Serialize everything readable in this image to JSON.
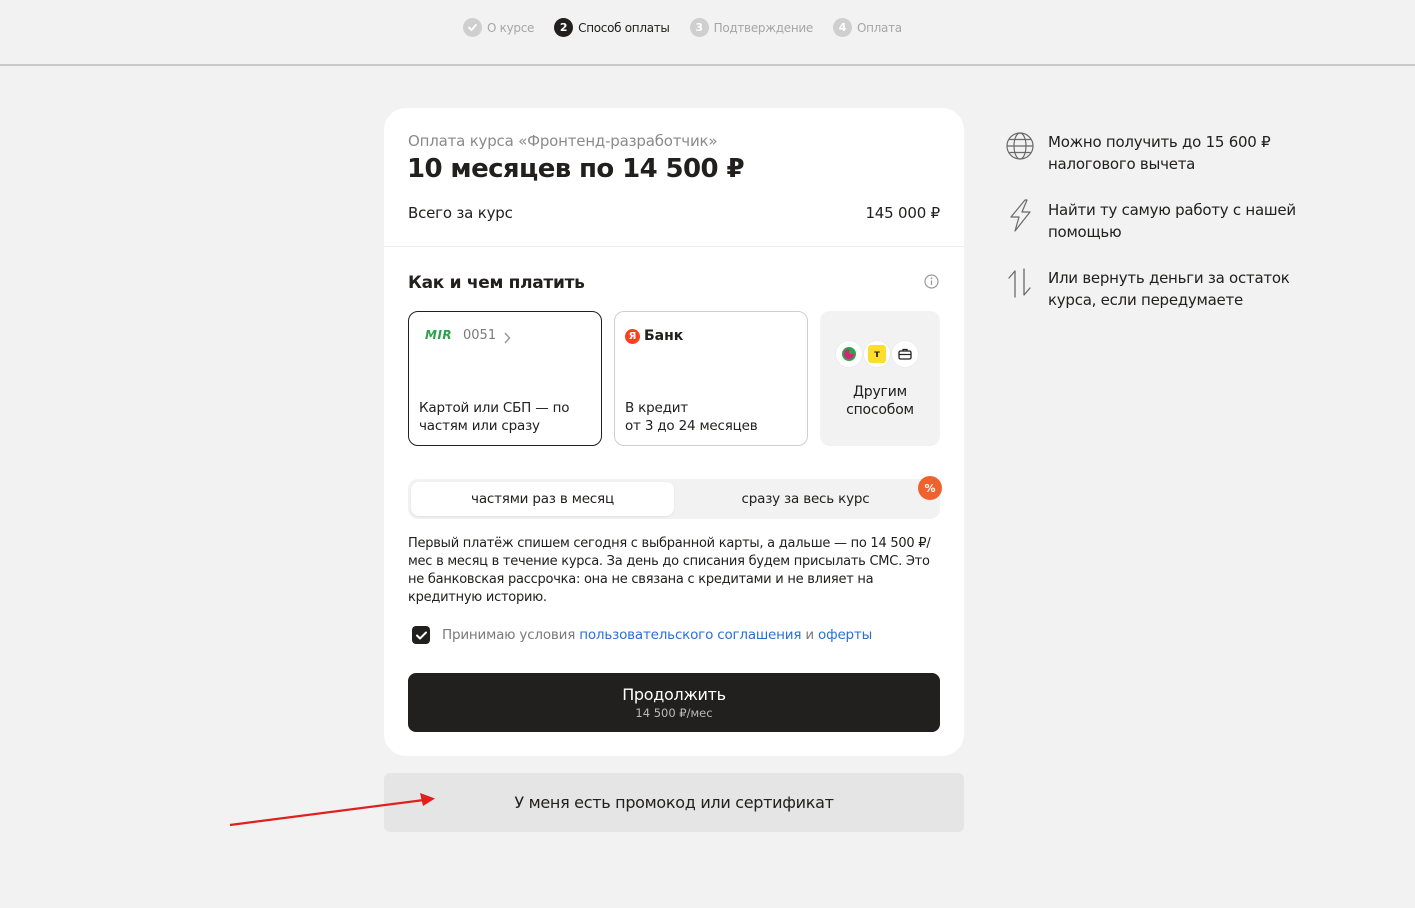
{
  "stepper": [
    {
      "label": "О курсе",
      "num": "",
      "state": "done"
    },
    {
      "label": "Способ оплаты",
      "num": "2",
      "state": "active"
    },
    {
      "label": "Подтверждение",
      "num": "3",
      "state": "todo"
    },
    {
      "label": "Оплата",
      "num": "4",
      "state": "todo"
    }
  ],
  "summary": {
    "course_title": "Оплата курса «Фронтенд-разработчик»",
    "price_main": "10 месяцев по 14 500 ₽",
    "total_label": "Всего за курс",
    "total_value": "145 000 ₽"
  },
  "payment": {
    "title": "Как и чем платить",
    "card_option": {
      "brand": "MIR",
      "last4": "0051",
      "text": "Картой или СБП — по частям или сразу"
    },
    "bank_option": {
      "logo_letter": "Я",
      "logo_text": "Банк",
      "text_line1": "В кредит",
      "text_line2": "от 3 до 24 месяцев"
    },
    "other_option": {
      "icon_t": "т",
      "text_line1": "Другим",
      "text_line2": "способом"
    },
    "segment": {
      "active": "частями раз в месяц",
      "inactive": "сразу за весь курс",
      "badge": "%"
    },
    "description": "Первый платёж спишем сегодня с выбранной карты, а дальше — по 14 500 ₽/мес в месяц в течение курса. За день до списания будем присылать СМС. Это не банковская рассрочка: она не связана с кредитами и не влияет на кредитную историю.",
    "agree": {
      "prefix": "Принимаю условия ",
      "link1": "пользовательского соглашения",
      "and": " и ",
      "link2": "оферты",
      "checked": true
    },
    "continue": {
      "label": "Продолжить",
      "sub": "14 500 ₽/мес"
    }
  },
  "promo_label": "У меня есть промокод или сертификат",
  "benefits": [
    {
      "icon": "globe-icon",
      "text": "Можно получить до 15 600 ₽ налогового вычета"
    },
    {
      "icon": "lightning-icon",
      "text": "Найти ту самую работу с нашей помощью"
    },
    {
      "icon": "arrows-updown-icon",
      "text": "Или вернуть деньги за остаток курса, если передумаете"
    }
  ],
  "colors": {
    "accent_dark": "#21201f",
    "link": "#2b6fd6",
    "badge": "#f0622d",
    "mir_green": "#2aa34a",
    "yandex_red": "#fc3f1d",
    "annotation_arrow": "#e0201e"
  }
}
